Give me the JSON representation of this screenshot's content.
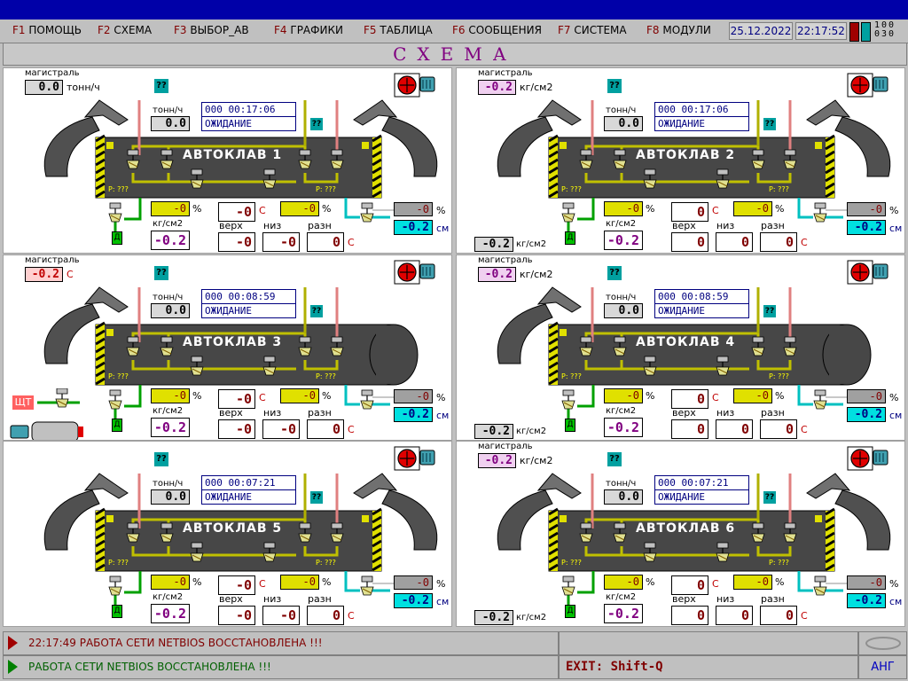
{
  "menu": {
    "items": [
      {
        "key": "F1",
        "label": "ПОМОЩЬ"
      },
      {
        "key": "F2",
        "label": "СХЕМА"
      },
      {
        "key": "F3",
        "label": "ВЫБОР_АВ"
      },
      {
        "key": "F4",
        "label": "ГРАФИКИ"
      },
      {
        "key": "F5",
        "label": "ТАБЛИЦА"
      },
      {
        "key": "F6",
        "label": "СООБЩЕНИЯ"
      },
      {
        "key": "F7",
        "label": "СИСТЕМА"
      },
      {
        "key": "F8",
        "label": "МОДУЛИ"
      }
    ],
    "date": "25.12.2022",
    "time": "22:17:52",
    "counter_top": "100",
    "counter_bottom": "030"
  },
  "page_title": "СХЕМА",
  "labels": {
    "main_line": "магистраль",
    "tph": "тонн/ч",
    "kgcm2": "кг/см2",
    "pct": "%",
    "top": "верх",
    "low": "низ",
    "diff": "разн",
    "cm": "см",
    "deg": "С",
    "qq": "??",
    "d": "Д",
    "p": "P:",
    "ppp": "???",
    "sht": "ЩТ"
  },
  "autoclaves": [
    {
      "name": "АВТОКЛАВ  1",
      "main_value": "0.0",
      "main_unit": "тонн/ч",
      "flow": "0.0",
      "timer_code": "000",
      "timer": "00:17:06",
      "status": "ОЖИДАНИЕ",
      "valve1": "-0",
      "t_top_left": "-0",
      "valve2": "-0",
      "right_val": "-0",
      "pressure": "-0.2",
      "t_top": "-0",
      "t_low": "-0",
      "t_diff": "0",
      "level": "-0.2",
      "ext_pressure": ""
    },
    {
      "name": "АВТОКЛАВ  2",
      "main_value": "-0.2",
      "main_unit": "кг/см2",
      "flow": "0.0",
      "timer_code": "000",
      "timer": "00:17:06",
      "status": "ОЖИДАНИЕ",
      "valve1": "-0",
      "t_top_left": "0",
      "valve2": "-0",
      "right_val": "-0",
      "pressure": "-0.2",
      "t_top": "0",
      "t_low": "0",
      "t_diff": "0",
      "level": "-0.2",
      "ext_pressure": "-0.2"
    },
    {
      "name": "АВТОКЛАВ  3",
      "main_value": "-0.2",
      "main_unit": "С",
      "flow": "0.0",
      "timer_code": "000",
      "timer": "00:08:59",
      "status": "ОЖИДАНИЕ",
      "valve1": "-0",
      "t_top_left": "-0",
      "valve2": "-0",
      "right_val": "-0",
      "pressure": "-0.2",
      "t_top": "-0",
      "t_low": "-0",
      "t_diff": "0",
      "level": "-0.2",
      "ext_pressure": ""
    },
    {
      "name": "АВТОКЛАВ  4",
      "main_value": "-0.2",
      "main_unit": "кг/см2",
      "flow": "0.0",
      "timer_code": "000",
      "timer": "00:08:59",
      "status": "ОЖИДАНИЕ",
      "valve1": "-0",
      "t_top_left": "0",
      "valve2": "-0",
      "right_val": "-0",
      "pressure": "-0.2",
      "t_top": "0",
      "t_low": "0",
      "t_diff": "0",
      "level": "-0.2",
      "ext_pressure": "-0.2"
    },
    {
      "name": "АВТОКЛАВ  5",
      "main_value": "",
      "main_unit": "",
      "flow": "0.0",
      "timer_code": "000",
      "timer": "00:07:21",
      "status": "ОЖИДАНИЕ",
      "valve1": "-0",
      "t_top_left": "-0",
      "valve2": "-0",
      "right_val": "-0",
      "pressure": "-0.2",
      "t_top": "-0",
      "t_low": "-0",
      "t_diff": "0",
      "level": "-0.2",
      "ext_pressure": ""
    },
    {
      "name": "АВТОКЛАВ  6",
      "main_value": "-0.2",
      "main_unit": "кг/см2",
      "flow": "0.0",
      "timer_code": "000",
      "timer": "00:07:21",
      "status": "ОЖИДАНИЕ",
      "valve1": "-0",
      "t_top_left": "0",
      "valve2": "-0",
      "right_val": "-0",
      "pressure": "-0.2",
      "t_top": "0",
      "t_low": "0",
      "t_diff": "0",
      "level": "-0.2",
      "ext_pressure": "-0.2"
    }
  ],
  "status": {
    "line1": "22:17:49 РАБОТА СЕТИ NETBIOS ВОССТАНОВЛЕНА !!!",
    "line2": "РАБОТА СЕТИ NETBIOS ВОССТАНОВЛЕНА !!!",
    "exit": "EXIT:  Shift-Q",
    "lang": "АНГ"
  },
  "colors": {
    "title_bar": "#0000a8",
    "tank_body": "#404040",
    "steam_pipe": "#e08080",
    "yellow_pipe": "#c0c000",
    "green_pipe": "#00a000",
    "cyan_pipe": "#00c0c0"
  }
}
